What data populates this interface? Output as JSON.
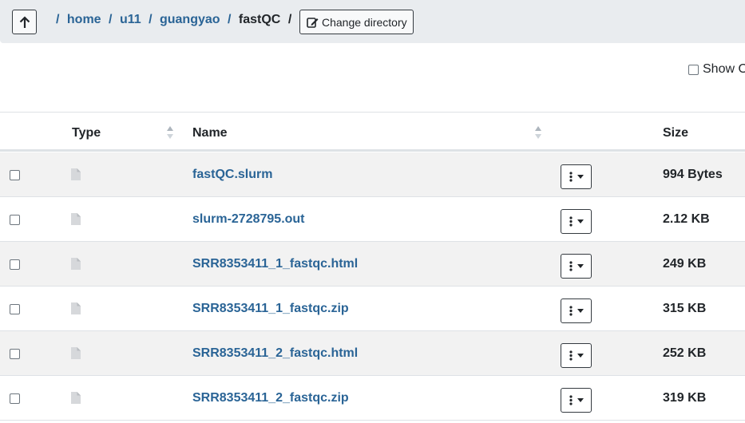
{
  "breadcrumb": {
    "root_sep": "/",
    "segments": [
      "home",
      "u11",
      "guangyao"
    ],
    "current": "fastQC",
    "trailing_sep": "/"
  },
  "toolbar": {
    "change_directory_label": "Change directory",
    "show_label": "Show O"
  },
  "table": {
    "columns": {
      "type": "Type",
      "name": "Name",
      "size": "Size"
    },
    "rows": [
      {
        "name": "fastQC.slurm",
        "size": "994 Bytes"
      },
      {
        "name": "slurm-2728795.out",
        "size": "2.12 KB"
      },
      {
        "name": "SRR8353411_1_fastqc.html",
        "size": "249 KB"
      },
      {
        "name": "SRR8353411_1_fastqc.zip",
        "size": "315 KB"
      },
      {
        "name": "SRR8353411_2_fastqc.html",
        "size": "252 KB"
      },
      {
        "name": "SRR8353411_2_fastqc.zip",
        "size": "319 KB"
      }
    ]
  },
  "icons": {
    "up": "arrow-up-icon",
    "edit": "edit-icon",
    "file": "file-icon",
    "menu": "ellipsis-vertical-icon",
    "caret": "caret-down-icon",
    "sort": "sort-icon"
  },
  "colors": {
    "link": "#2a6496",
    "topbar_bg": "#e9ecef",
    "stripe": "#f2f2f2"
  }
}
